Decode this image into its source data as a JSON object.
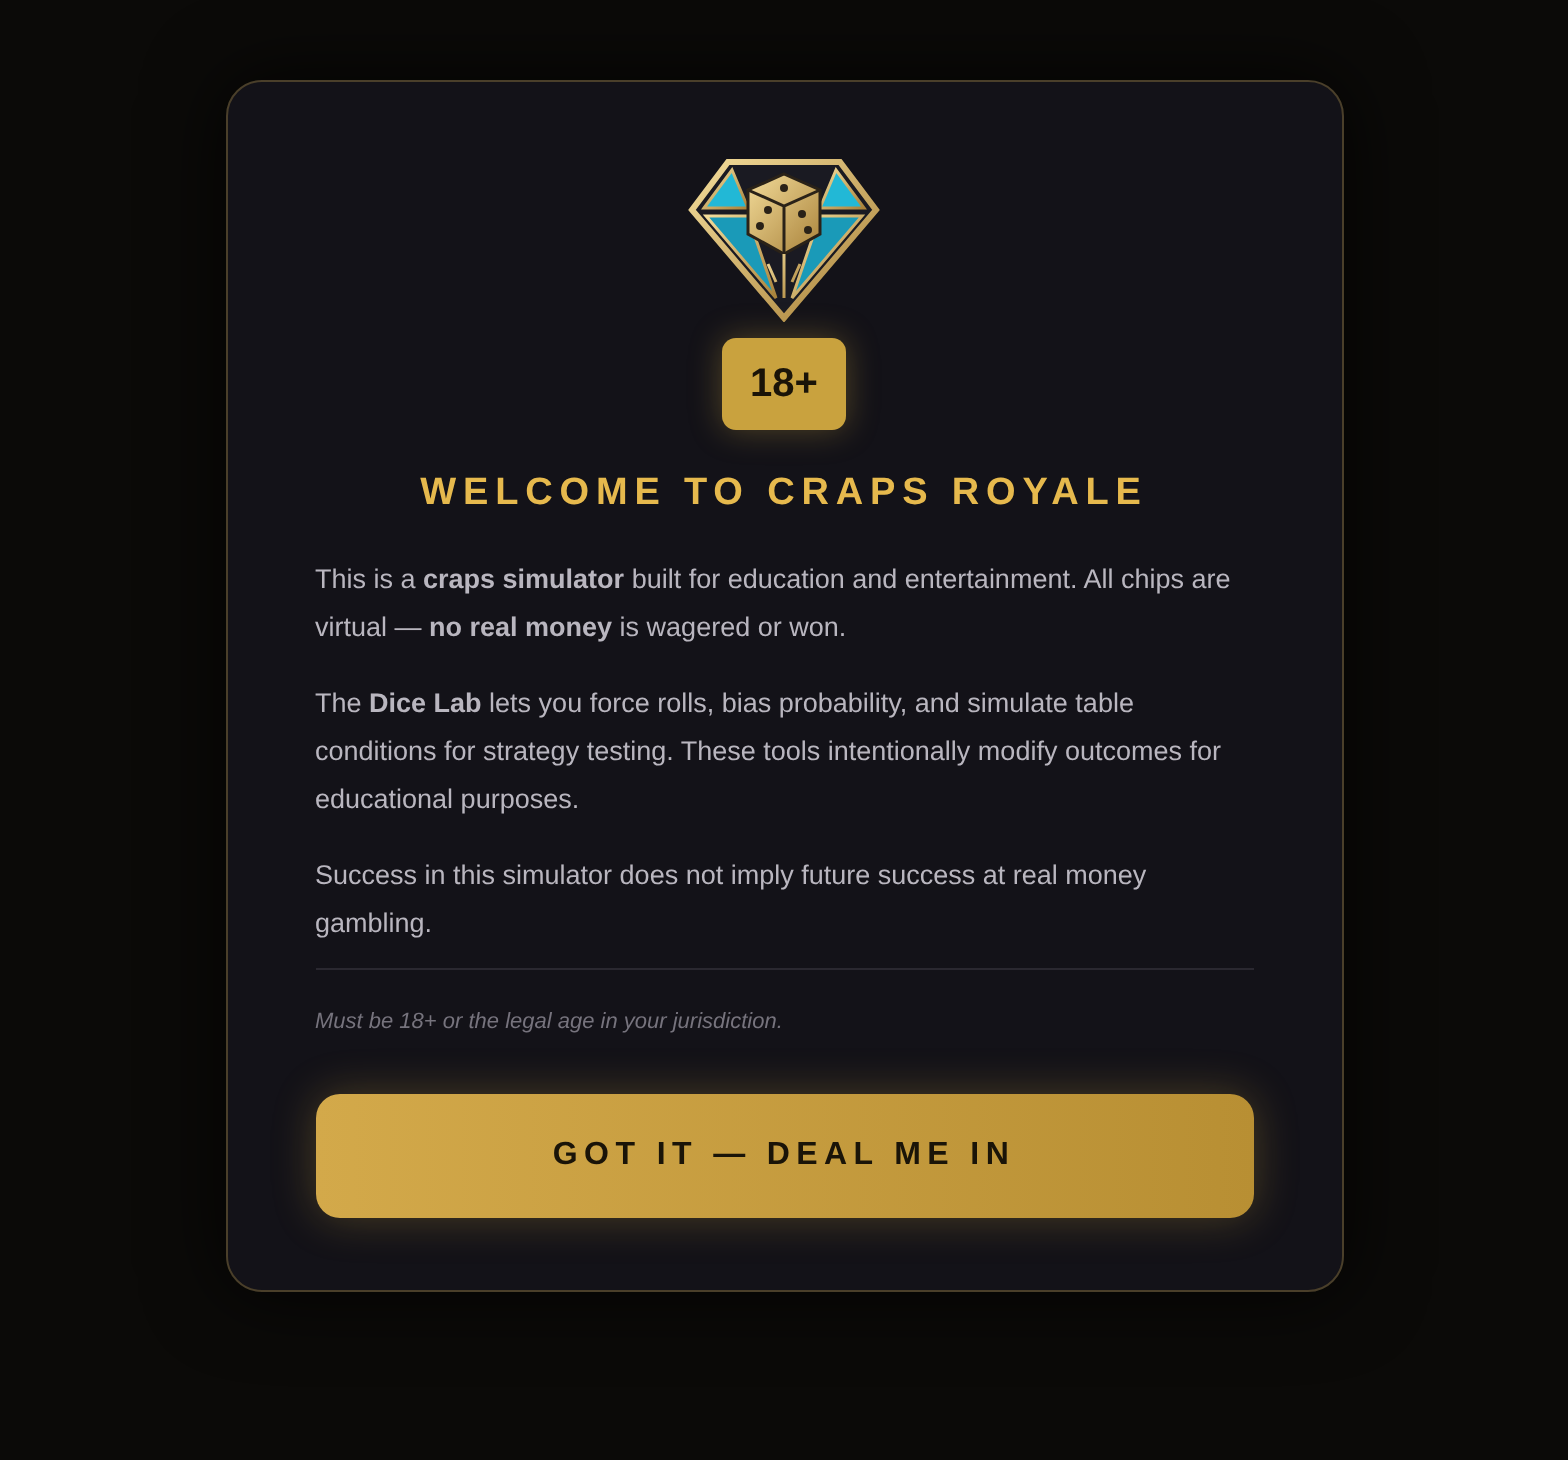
{
  "modal": {
    "badge": "18+",
    "title": "WELCOME TO CRAPS ROYALE",
    "paragraphs": [
      "This is a **craps simulator** built for education and entertainment. All chips are virtual — **no real money** is wagered or won.",
      "The **Dice Lab** lets you force rolls, bias probability, and simulate table conditions for strategy testing. These tools intentionally modify outcomes for educational purposes.",
      "Success in this simulator does not imply future success at real money gambling."
    ],
    "disclaimer": "Must be 18+ or the legal age in your jurisdiction.",
    "button": "GOT IT — DEAL ME IN"
  }
}
